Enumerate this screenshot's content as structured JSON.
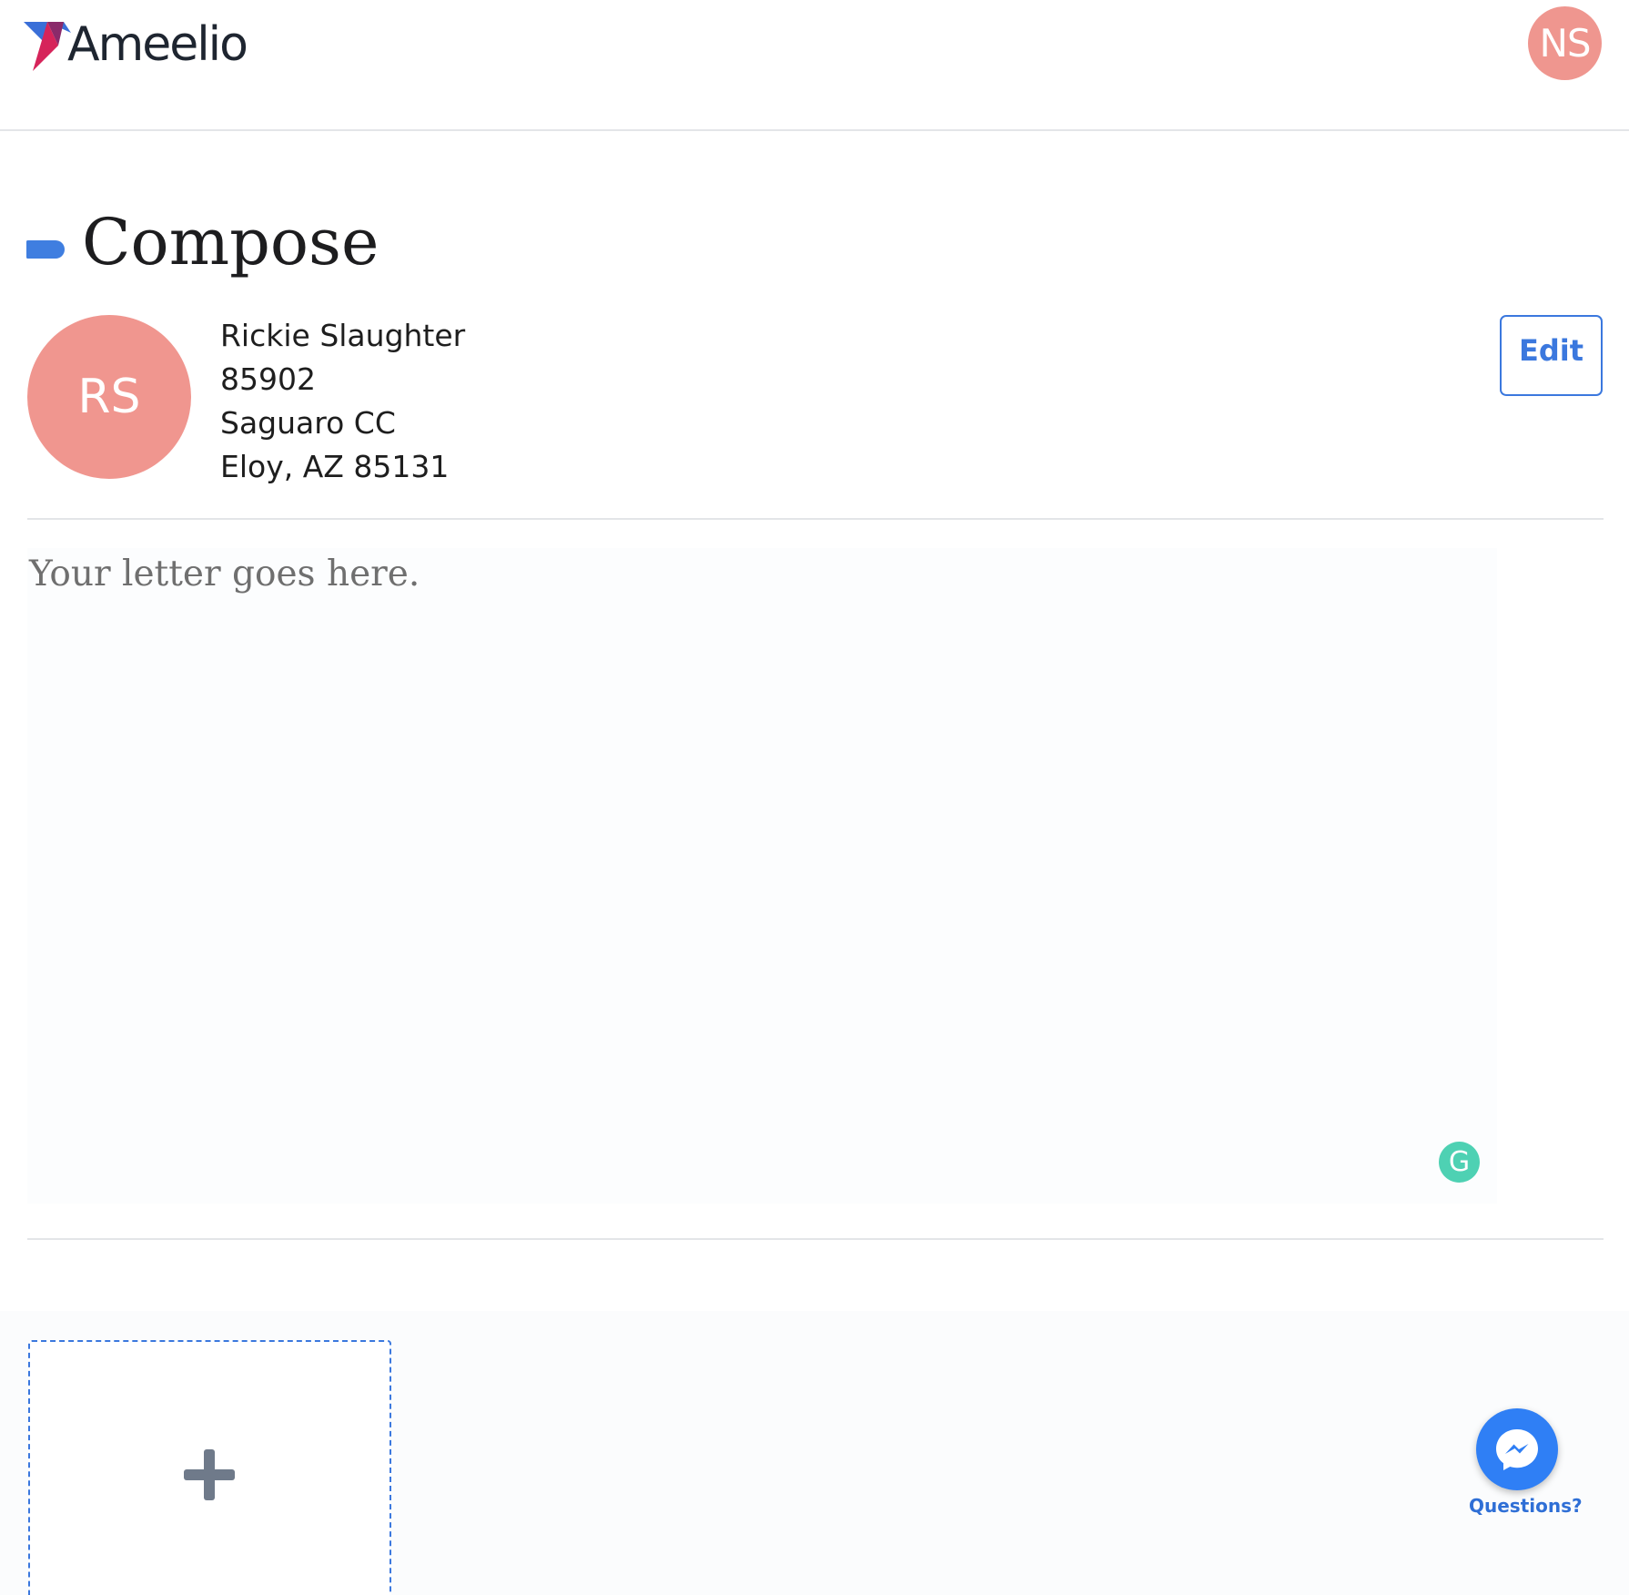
{
  "header": {
    "brand": "Ameelio",
    "user_initials": "NS"
  },
  "page": {
    "title": "Compose"
  },
  "recipient": {
    "initials": "RS",
    "name": "Rickie Slaughter",
    "inmate_number": "85902",
    "facility": "Saguaro CC",
    "city_state_zip": "Eloy, AZ 85131",
    "edit_label": "Edit"
  },
  "letter": {
    "placeholder": "Your letter goes here.",
    "grammarly_glyph": "G"
  },
  "attachments": {
    "add_icon": "plus-icon"
  },
  "support": {
    "label": "Questions?",
    "icon": "messenger-icon"
  },
  "colors": {
    "accent": "#3b78de",
    "avatar": "#ef968f",
    "messenger": "#2f7ff5"
  }
}
